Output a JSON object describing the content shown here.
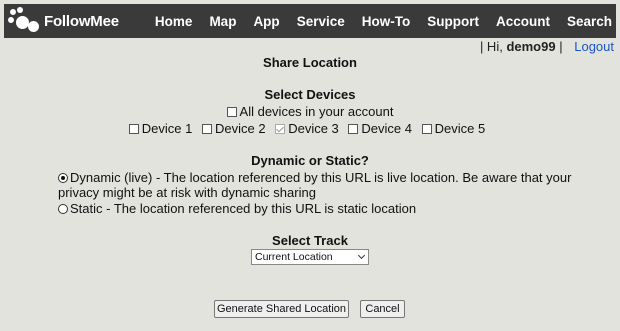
{
  "brand": {
    "name": "FollowMee"
  },
  "nav": [
    "Home",
    "Map",
    "App",
    "Service",
    "How-To",
    "Support",
    "Account",
    "Search"
  ],
  "user": {
    "prefix": "| Hi,",
    "username": "demo99",
    "suffix": "|",
    "logout": "Logout"
  },
  "page": {
    "title": "Share Location"
  },
  "devices": {
    "heading": "Select Devices",
    "all_label": "All devices in your account",
    "all_checked": false,
    "items": [
      {
        "label": "Device 1",
        "checked": false
      },
      {
        "label": "Device 2",
        "checked": false
      },
      {
        "label": "Device 3",
        "checked": true
      },
      {
        "label": "Device 4",
        "checked": false
      },
      {
        "label": "Device 5",
        "checked": false
      }
    ]
  },
  "mode": {
    "heading": "Dynamic or Static?",
    "dynamic_label": "Dynamic (live) - The location referenced by this URL is live location. Be aware that your privacy might be at risk with dynamic sharing",
    "static_label": "Static - The location referenced by this URL is static location",
    "selected": "dynamic"
  },
  "track": {
    "heading": "Select Track",
    "selected": "Current Location"
  },
  "buttons": {
    "generate": "Generate Shared Location",
    "cancel": "Cancel"
  }
}
